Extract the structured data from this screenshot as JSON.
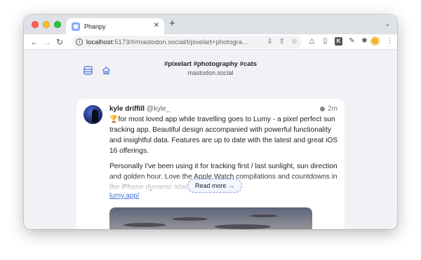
{
  "browser": {
    "tab_title": "Phanpy",
    "tab_favicon": "phanpy-favicon",
    "url_host": "localhost",
    "url_rest": ":5173/#/mastodon.social/t/pixelart+photogra..."
  },
  "header": {
    "hashtags": "#pixelart #photography #cats",
    "instance": "mastodon.social"
  },
  "post": {
    "author_name": "kyle driffill",
    "author_handle": "@kyle_",
    "time": "2m",
    "trophy": "🏆",
    "paragraph1": "for most loved app while travelling goes to Lumy - a pixel perfect sun tracking app. Beautiful design accompanied with powerful functionality and insightful data. Features are up to date with the latest and great iOS 16 offerings.",
    "paragraph2": "Personally I've been using it for tracking first / last sunlight, sun direction and golden hour. Love the Apple Watch compilations and countdowns in the iPhone dynamic island",
    "link": "lumy.app/",
    "read_more": "Read more →"
  },
  "colors": {
    "accent": "#4a72d8",
    "window_bg": "#f2f2f6"
  }
}
